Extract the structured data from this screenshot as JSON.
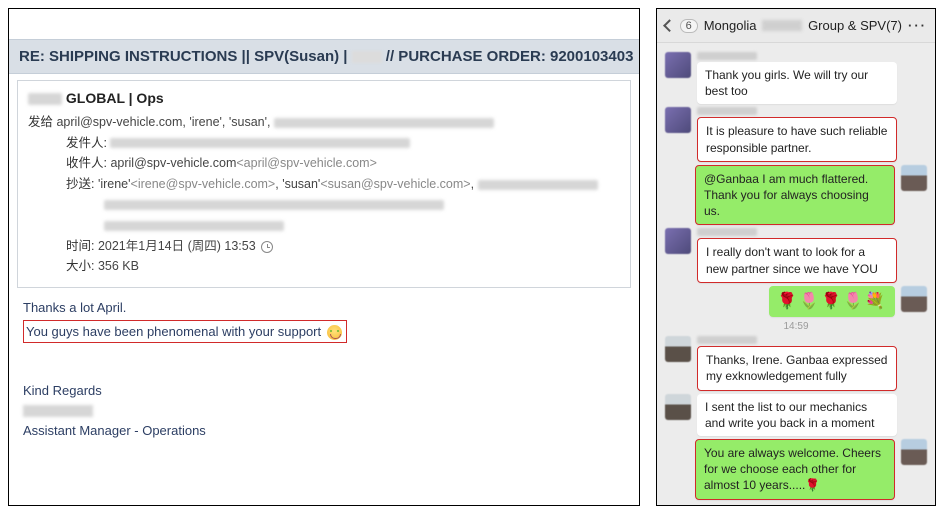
{
  "email": {
    "subject_prefix": "RE: SHIPPING INSTRUCTIONS || SPV(Susan) | ",
    "subject_suffix": " // PURCHASE ORDER: 9200103403",
    "sender_suffix": " GLOBAL | Ops",
    "sent_to_label": "发给 ",
    "sent_to_value": "april@spv-vehicle.com, 'irene', 'susan', ",
    "from_label": "发件人: ",
    "to_label": "收件人: ",
    "to_value": "april@spv-vehicle.com",
    "to_value_dim": "<april@spv-vehicle.com>",
    "cc_label": "抄送: ",
    "cc_value_1": "'irene'",
    "cc_value_1_dim": "<irene@spv-vehicle.com>",
    "cc_sep": ",  ",
    "cc_value_2": "'susan'",
    "cc_value_2_dim": "<susan@spv-vehicle.com>",
    "cc_tail": ", ",
    "time_label": "时间: ",
    "time_value": "2021年1月14日 (周四) 13:53",
    "size_label": "大小: ",
    "size_value": "356 KB",
    "body_line1": "Thanks a lot April.",
    "body_highlight": "You guys have been phenomenal with your support ",
    "regards": "Kind Regards",
    "title": "Assistant Manager - Operations"
  },
  "chat": {
    "unread": "6",
    "title_prefix": "Mongolia ",
    "title_suffix": " Group & SPV(7)",
    "messages": {
      "m1": "Thank you girls. We will try our best too",
      "m2": "It is pleasure to have such reliable responsible partner.",
      "m3": "@Ganbaa I am much flattered. Thank you for always choosing us.",
      "m4": "I really don't want to look for a new partner since we have YOU",
      "m5": "🌹🌷🌹🌷💐",
      "ts": "14:59",
      "m6": "Thanks, Irene. Ganbaa expressed my exknowledgement fully",
      "m7": "I sent the list to our mechanics and write you back in a moment",
      "m8": "You are always welcome. Cheers for we choose each other for almost 10 years.....🌹"
    }
  }
}
